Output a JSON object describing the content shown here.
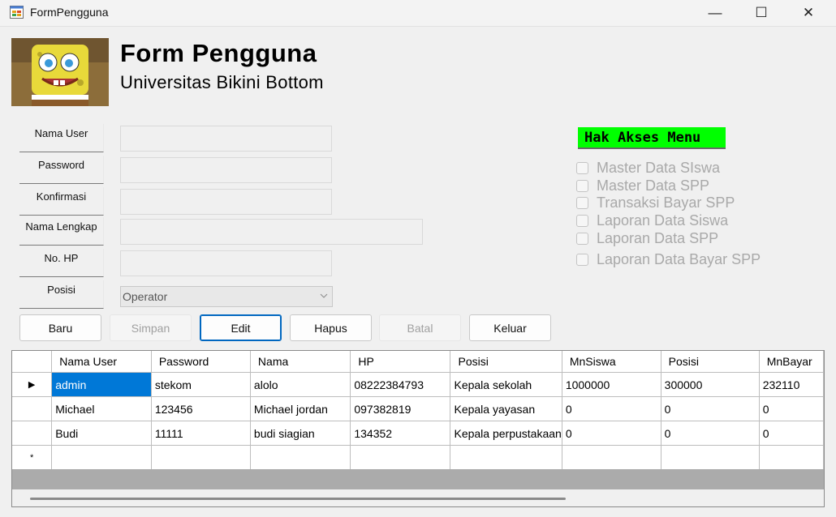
{
  "window": {
    "title": "FormPengguna",
    "controls": {
      "minimize": "—",
      "maximize": "☐",
      "close": "✕"
    }
  },
  "header": {
    "title": "Form Pengguna",
    "subtitle": "Universitas Bikini Bottom"
  },
  "form": {
    "fields": [
      {
        "label": "Nama User",
        "value": ""
      },
      {
        "label": "Password",
        "value": ""
      },
      {
        "label": "Konfirmasi",
        "value": ""
      },
      {
        "label": "Nama Lengkap",
        "value": ""
      },
      {
        "label": "No. HP",
        "value": ""
      },
      {
        "label": "Posisi",
        "value": "Operator"
      }
    ]
  },
  "buttons": [
    {
      "label": "Baru",
      "enabled": true
    },
    {
      "label": "Simpan",
      "enabled": false
    },
    {
      "label": "Edit",
      "enabled": true
    },
    {
      "label": "Hapus",
      "enabled": true
    },
    {
      "label": "Batal",
      "enabled": false
    },
    {
      "label": "Keluar",
      "enabled": true
    }
  ],
  "hak_akses": {
    "title": "Hak Akses Menu",
    "items": [
      {
        "label": "Master Data SIswa",
        "checked": false
      },
      {
        "label": "Master Data SPP",
        "checked": false
      },
      {
        "label": "Transaksi Bayar SPP",
        "checked": false
      },
      {
        "label": "Laporan Data Siswa",
        "checked": false
      },
      {
        "label": "Laporan Data SPP",
        "checked": false
      },
      {
        "label": "Laporan Data Bayar SPP",
        "checked": false
      }
    ]
  },
  "grid": {
    "columns": [
      "Nama User",
      "Password",
      "Nama",
      "HP",
      "Posisi",
      "MnSiswa",
      "Posisi",
      "MnBayar"
    ],
    "rows": [
      {
        "indicator": "▶",
        "cells": [
          "admin",
          "stekom",
          "alolo",
          "08222384793",
          "Kepala sekolah",
          "1000000",
          "300000",
          "232110"
        ]
      },
      {
        "indicator": "",
        "cells": [
          "Michael",
          "123456",
          "Michael jordan",
          "097382819",
          "Kepala yayasan",
          "0",
          "0",
          "0"
        ]
      },
      {
        "indicator": "",
        "cells": [
          "Budi",
          "11111",
          "budi siagian",
          "134352",
          "Kepala perpustakaan",
          "0",
          "0",
          "0"
        ]
      }
    ],
    "new_row_indicator": "*"
  },
  "colors": {
    "selection": "#0078d7",
    "hak_akses_bg": "#00ff00",
    "focus_border": "#0067c0"
  }
}
